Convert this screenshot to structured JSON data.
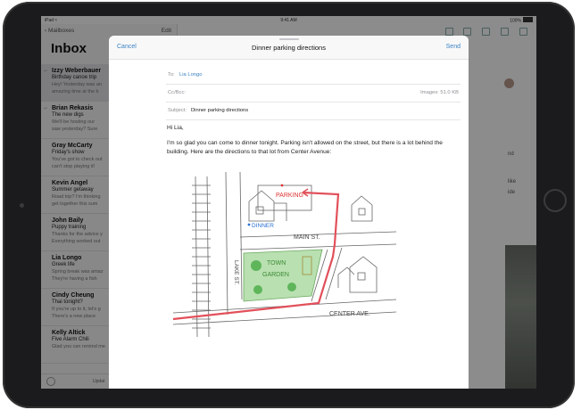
{
  "status": {
    "left": "iPad ≈",
    "time": "9:41 AM",
    "battery": "100%"
  },
  "sidebar": {
    "back_label": "Mailboxes",
    "edit_label": "Edit",
    "title": "Inbox",
    "updated_label": "Updat",
    "mails": [
      {
        "from": "Izzy Weberbauer",
        "subject": "Birthday canoe trip",
        "preview1": "Hey! Yesterday was an",
        "preview2": "amazing time at the b"
      },
      {
        "from": "Brian Rekasis",
        "subject": "The new digs",
        "preview1": "We'll be hosting our",
        "preview2": "saw yesterday? Sure"
      },
      {
        "from": "Gray McCarty",
        "subject": "Friday's show",
        "preview1": "You've got to check out",
        "preview2": "can't stop playing it!"
      },
      {
        "from": "Kevin Angel",
        "subject": "Summer getaway",
        "preview1": "Road trip? I'm thinking",
        "preview2": "get together this sum"
      },
      {
        "from": "John Baily",
        "subject": "Puppy training",
        "preview1": "Thanks for the advice y",
        "preview2": "Everything worked out"
      },
      {
        "from": "Lia Longo",
        "subject": "Greek life",
        "preview1": "Spring break was amaz",
        "preview2": "They're having a fish"
      },
      {
        "from": "Cindy Cheung",
        "subject": "Thai tonight?",
        "preview1": "If you're up to it, let's g",
        "preview2": "There's a new place"
      },
      {
        "from": "Kelly Altick",
        "subject": "Five Alarm Chili",
        "preview1": "Glad you can remind me",
        "preview2": ""
      }
    ]
  },
  "right_fragments": [
    "nd",
    "like",
    "ide"
  ],
  "compose": {
    "cancel_label": "Cancel",
    "title": "Dinner parking directions",
    "send_label": "Send",
    "to_label": "To:",
    "to_value": "Lia Longo",
    "ccbcc_label": "Cc/Bcc:",
    "images_label": "Images: 51.0 KB",
    "subject_label": "Subject:",
    "subject_value": "Dinner parking directions",
    "greeting": "Hi Lia,",
    "body_text": "I'm so glad you can come to dinner tonight. Parking isn't allowed on the street, but there is a lot behind the building. Here are the directions to that lot from Center Avenue:"
  },
  "map": {
    "parking_label": "PARKING",
    "dinner_label": "DINNER",
    "main_st_label": "MAIN ST.",
    "lake_st_label": "LAKE ST.",
    "town_label": "TOWN",
    "garden_label": "GARDEN",
    "center_ave_label": "CENTER AVE."
  }
}
